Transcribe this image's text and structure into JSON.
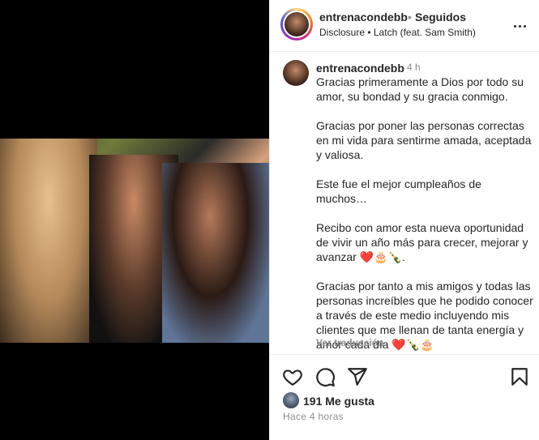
{
  "header": {
    "username": "entrenacondebb",
    "separator": "•",
    "follow_status": "Seguidos",
    "song": "Disclosure • Latch (feat. Sam Smith)"
  },
  "caption": {
    "username": "entrenacondebb",
    "time": "4 h",
    "paragraphs": [
      "Gracias primeramente a Dios por todo su amor, su bondad y su gracia conmigo.",
      "Gracias por poner las personas correctas en mi vida para sentirme amada, aceptada y valiosa.",
      "Este fue el mejor cumpleaños de muchos…",
      "Recibo con amor esta nueva oportunidad de vivir un año más para crecer, mejorar y avanzar ❤️🎂🍾.",
      "Gracias por tanto a mis amigos y todas las personas increíbles que he podido conocer a través de este medio incluyendo mis clientes que me llenan de tanta energía y amor cada día ❤️🍾🎂"
    ],
    "translate_label": "Ver traducción"
  },
  "actions": {
    "like_icon": "heart-icon",
    "comment_icon": "comment-icon",
    "share_icon": "share-icon",
    "save_icon": "bookmark-icon"
  },
  "likes": {
    "text": "191 Me gusta"
  },
  "posted_ago": "Hace 4 horas",
  "colors": {
    "text": "#262626",
    "muted": "#8e8e8e",
    "border": "#efefef"
  }
}
